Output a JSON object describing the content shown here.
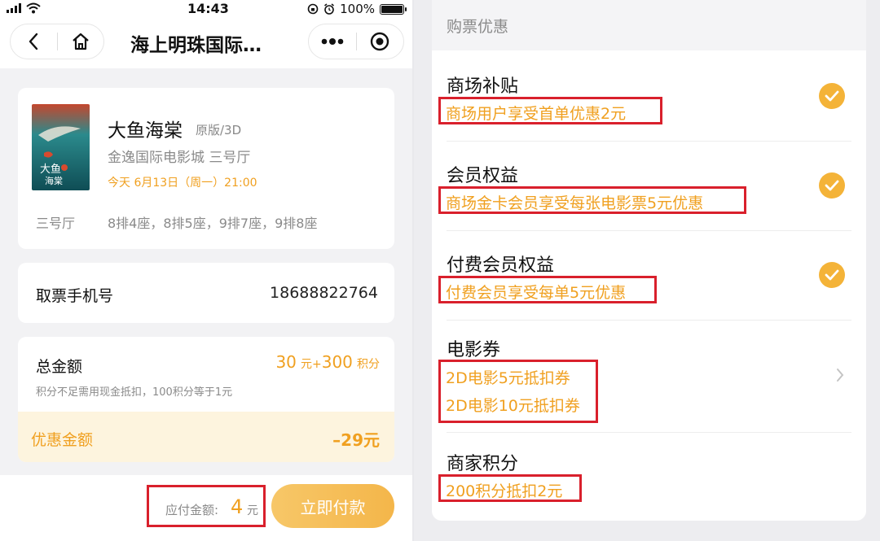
{
  "status_bar": {
    "time": "14:43",
    "battery": "100%"
  },
  "nav": {
    "title": "海上明珠国际…"
  },
  "movie": {
    "title": "大鱼海棠",
    "version": "原版/3D",
    "cinema": "金逸国际电影城 三号厅",
    "showtime": "今天 6月13日（周一）21:00",
    "hall": "三号厅",
    "seats": "8排4座，8排5座，9排7座，9排8座"
  },
  "phone": {
    "label": "取票手机号",
    "value": "18688822764"
  },
  "total": {
    "label": "总金额",
    "cash": "30",
    "cash_unit": "元+",
    "points": "300",
    "points_unit": "积分",
    "note": "积分不足需用现金抵扣，100积分等于1元"
  },
  "discount": {
    "label": "优惠金额",
    "value": "–29元"
  },
  "payment": {
    "label": "应付金额:",
    "amount": "4",
    "unit": "元",
    "button": "立即付款"
  },
  "promotions": {
    "header": "购票优惠",
    "sections": [
      {
        "title": "商场补贴",
        "items": [
          "商场用户享受首单优惠2元"
        ],
        "checked": true
      },
      {
        "title": "会员权益",
        "items": [
          "商场金卡会员享受每张电影票5元优惠"
        ],
        "checked": true
      },
      {
        "title": "付费会员权益",
        "items": [
          "付费会员享受每单5元优惠"
        ],
        "checked": true
      },
      {
        "title": "电影券",
        "items": [
          "2D电影5元抵扣券",
          "2D电影10元抵扣券"
        ],
        "checked": false
      },
      {
        "title": "商家积分",
        "items": [
          "200积分抵扣2元"
        ],
        "checked": false
      }
    ]
  },
  "colors": {
    "accent": "#f0a020",
    "highlight_border": "#d9202c",
    "check": "#f4b338"
  },
  "icons": [
    "back-icon",
    "home-icon",
    "more-icon",
    "target-icon",
    "check-icon",
    "chevron-right-icon"
  ]
}
